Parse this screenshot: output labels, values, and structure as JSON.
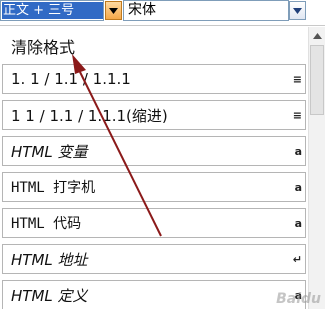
{
  "toolbar": {
    "style_value": "正文 + 三号",
    "font_value": "宋体"
  },
  "style_list": [
    {
      "label": "清除格式",
      "mark": "",
      "style": "clear"
    },
    {
      "label": "1.  1 / 1.1 / 1.1.1",
      "mark": "≡",
      "style": "normal"
    },
    {
      "label": "1  1 / 1.1 / 1.1.1(缩进)",
      "mark": "≡",
      "style": "normal"
    },
    {
      "label": "HTML 变量",
      "mark": "a",
      "style": "italic"
    },
    {
      "label": "HTML 打字机",
      "mark": "a",
      "style": "mono"
    },
    {
      "label": "HTML 代码",
      "mark": "a",
      "style": "mono"
    },
    {
      "label": "HTML 地址",
      "mark": "↵",
      "style": "italic"
    },
    {
      "label": "HTML 定义",
      "mark": "a",
      "style": "italic"
    }
  ],
  "colors": {
    "selection": "#316ac5",
    "annotation_arrow": "#8b1a1a",
    "dropdown_active": "#f5a94a"
  }
}
